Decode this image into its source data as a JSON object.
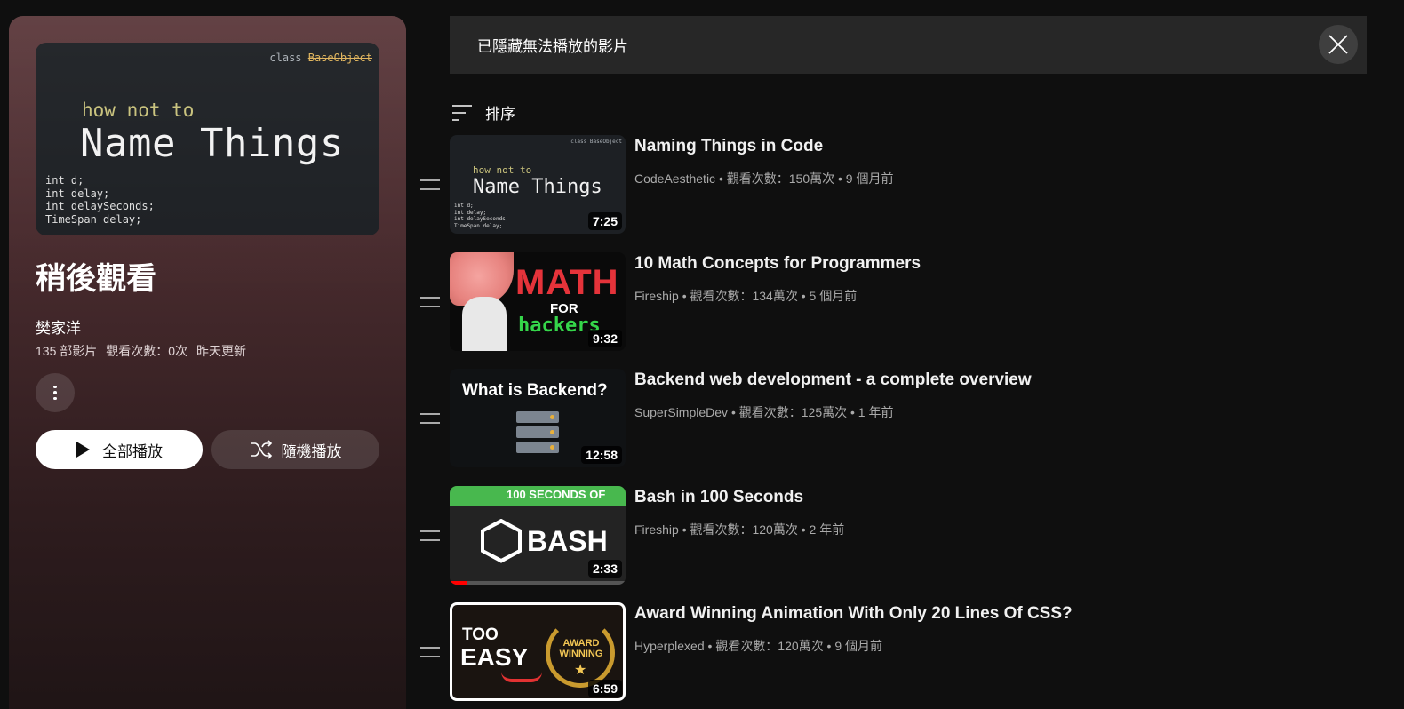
{
  "notice": {
    "text": "已隱藏無法播放的影片"
  },
  "playlist": {
    "hero_thumb": {
      "class_label": "class",
      "class_name": "BaseObject",
      "line1": "how not to",
      "line2": "Name Things",
      "vars": [
        "int d;",
        "int delay;",
        "int delaySeconds;",
        "TimeSpan delay;"
      ]
    },
    "title": "稍後觀看",
    "owner": "樊家洋",
    "video_count": "135 部影片",
    "views": "觀看次數：0次",
    "updated": "昨天更新",
    "play_all_label": "全部播放",
    "shuffle_label": "隨機播放"
  },
  "sort": {
    "label": "排序"
  },
  "videos": [
    {
      "title": "Naming Things in Code",
      "channel": "CodeAesthetic",
      "views": "觀看次數：150萬次",
      "age": "9 個月前",
      "duration": "7:25",
      "thumb_text": {
        "cls": "class BaseObject",
        "l1": "how not to",
        "l2": "Name Things"
      }
    },
    {
      "title": "10 Math Concepts for Programmers",
      "channel": "Fireship",
      "views": "觀看次數：134萬次",
      "age": "5 個月前",
      "duration": "9:32",
      "thumb_text": {
        "l1": "MATH",
        "l2": "FOR",
        "l3": "hackers"
      }
    },
    {
      "title": "Backend web development - a complete overview",
      "channel": "SuperSimpleDev",
      "views": "觀看次數：125萬次",
      "age": "1 年前",
      "duration": "12:58",
      "thumb_text": {
        "l1": "What is Backend?"
      }
    },
    {
      "title": "Bash in 100 Seconds",
      "channel": "Fireship",
      "views": "觀看次數：120萬次",
      "age": "2 年前",
      "duration": "2:33",
      "watch_progress": 0.1,
      "thumb_text": {
        "l1": "100 SECONDS OF",
        "l2": "BASH"
      }
    },
    {
      "title": "Award Winning Animation With Only 20 Lines Of CSS?",
      "channel": "Hyperplexed",
      "views": "觀看次數：120萬次",
      "age": "9 個月前",
      "duration": "6:59",
      "thumb_text": {
        "l1": "TOO",
        "l2": "EASY",
        "l3": "AWARD WINNING"
      }
    }
  ],
  "separator": "•",
  "colors": {
    "background": "#0f0f0f",
    "panel": "#4a2c2f",
    "accent_red": "#ff0000",
    "meta_text": "#aaaaaa"
  }
}
